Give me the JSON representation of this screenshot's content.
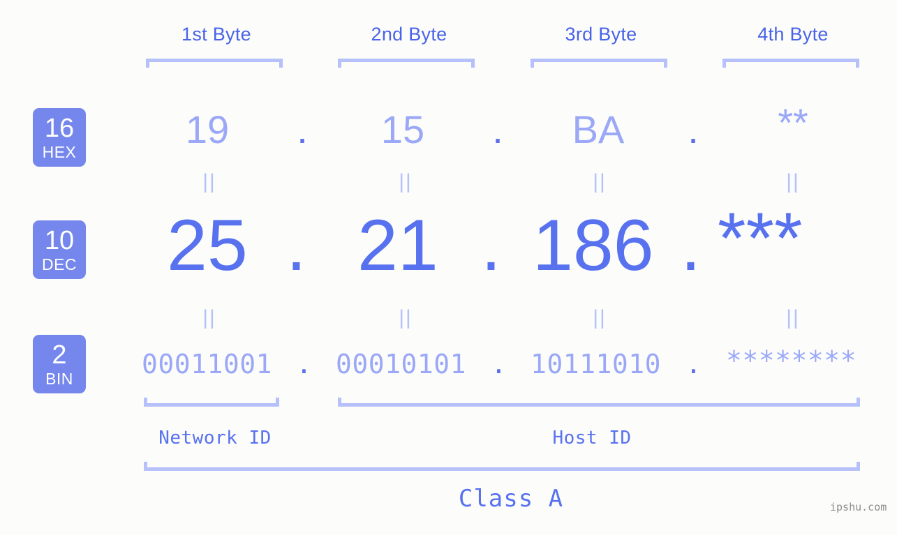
{
  "meta": {
    "background_color": "#fcfdfa",
    "accent_color": "#5871ef",
    "badge_color": "#7587ec",
    "muted_color": "#9aa8f7",
    "bracket_color": "#b6c0fb",
    "watermark": "ipshu.com"
  },
  "headers": [
    {
      "label": "1st Byte"
    },
    {
      "label": "2nd Byte"
    },
    {
      "label": "3rd Byte"
    },
    {
      "label": "4th Byte"
    }
  ],
  "radix_badges": [
    {
      "number": "16",
      "name": "HEX"
    },
    {
      "number": "10",
      "name": "DEC"
    },
    {
      "number": "2",
      "name": "BIN"
    }
  ],
  "rows": {
    "hex": {
      "radix": "16",
      "radix_name": "HEX",
      "values": [
        "19",
        "15",
        "BA",
        "**"
      ],
      "separator": "."
    },
    "dec": {
      "radix": "10",
      "radix_name": "DEC",
      "values": [
        "25",
        "21",
        "186",
        "***"
      ],
      "separator": "."
    },
    "bin": {
      "radix": "2",
      "radix_name": "BIN",
      "values": [
        "00011001",
        "00010101",
        "10111010",
        "********"
      ],
      "separator": "."
    }
  },
  "equality_marks": {
    "symbol": "||",
    "hex_to_dec_count": 4,
    "dec_to_bin_count": 4
  },
  "segments": {
    "network_id": {
      "label": "Network ID"
    },
    "host_id": {
      "label": "Host ID"
    },
    "ip_class": {
      "label": "Class A"
    }
  }
}
